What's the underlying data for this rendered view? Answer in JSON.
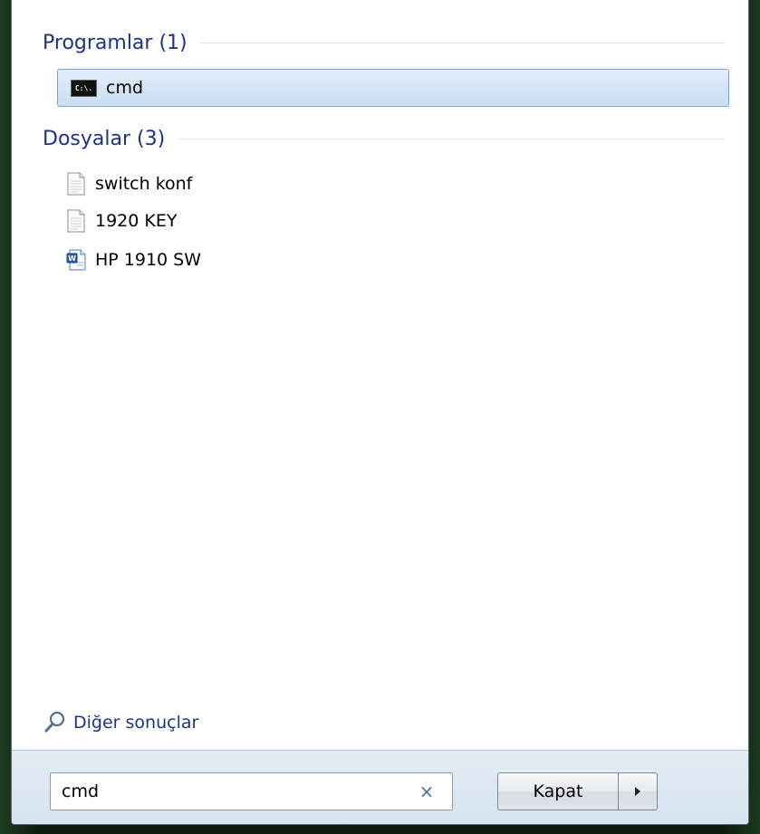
{
  "programs": {
    "header": "Programlar (1)",
    "items": [
      {
        "label": "cmd",
        "icon": "command-prompt-icon",
        "icon_text": "C:\\."
      }
    ]
  },
  "files": {
    "header": "Dosyalar (3)",
    "items": [
      {
        "label": "switch konf",
        "icon": "text-document-icon"
      },
      {
        "label": "1920 KEY",
        "icon": "text-document-icon"
      },
      {
        "label": "HP 1910 SW",
        "icon": "word-document-icon"
      }
    ]
  },
  "more_results": {
    "label": "Diğer sonuçlar",
    "icon": "search-icon"
  },
  "search": {
    "value": "cmd",
    "clear_icon": "close-icon"
  },
  "shutdown": {
    "label": "Kapat",
    "arrow_icon": "chevron-right-icon"
  },
  "colors": {
    "header": "#1e3287",
    "highlight": "#d6e6f7",
    "highlight_border": "#7da2ce"
  }
}
